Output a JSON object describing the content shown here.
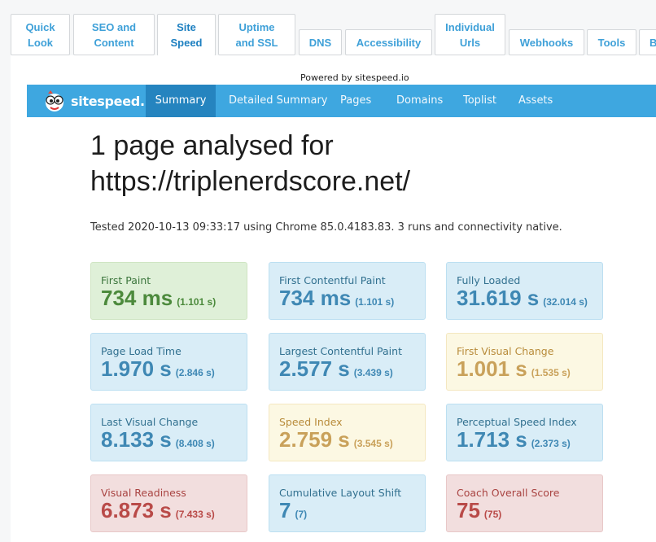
{
  "tabs": [
    {
      "label": "Quick\nLook",
      "active": false
    },
    {
      "label": "SEO and\nContent",
      "active": false
    },
    {
      "label": "Site\nSpeed",
      "active": true
    },
    {
      "label": "Uptime\nand SSL",
      "active": false
    },
    {
      "label": "DNS",
      "active": false
    },
    {
      "label": "Accessibility",
      "active": false
    },
    {
      "label": "Individual\nUrls",
      "active": false
    },
    {
      "label": "Webhooks",
      "active": false
    },
    {
      "label": "Tools",
      "active": false
    },
    {
      "label": "B",
      "active": false
    }
  ],
  "powered_by": "Powered by sitespeed.io",
  "navbar": {
    "brand": "sitespeed.io",
    "links": [
      "Summary",
      "Detailed Summary",
      "Pages",
      "Domains",
      "Toplist",
      "Assets"
    ],
    "active": "Summary"
  },
  "heading": "1 page analysed for https://triplenerdscore.net/",
  "tested": "Tested 2020-10-13 09:33:17 using Chrome 85.0.4183.83. 3 runs and connectivity native.",
  "metrics": [
    {
      "label": "First Paint",
      "value": "734 ms",
      "sub": "(1.101 s)",
      "status": "green"
    },
    {
      "label": "First Contentful Paint",
      "value": "734 ms",
      "sub": "(1.101 s)",
      "status": "blue"
    },
    {
      "label": "Fully Loaded",
      "value": "31.619 s",
      "sub": "(32.014 s)",
      "status": "blue"
    },
    {
      "label": "Page Load Time",
      "value": "1.970 s",
      "sub": "(2.846 s)",
      "status": "blue"
    },
    {
      "label": "Largest Contentful Paint",
      "value": "2.577 s",
      "sub": "(3.439 s)",
      "status": "blue"
    },
    {
      "label": "First Visual Change",
      "value": "1.001 s",
      "sub": "(1.535 s)",
      "status": "yellow"
    },
    {
      "label": "Last Visual Change",
      "value": "8.133 s",
      "sub": "(8.408 s)",
      "status": "blue"
    },
    {
      "label": "Speed Index",
      "value": "2.759 s",
      "sub": "(3.545 s)",
      "status": "yellow"
    },
    {
      "label": "Perceptual Speed Index",
      "value": "1.713 s",
      "sub": "(2.373 s)",
      "status": "blue"
    },
    {
      "label": "Visual Readiness",
      "value": "6.873 s",
      "sub": "(7.433 s)",
      "status": "red"
    },
    {
      "label": "Cumulative Layout Shift",
      "value": "7",
      "sub": "(7)",
      "status": "blue"
    },
    {
      "label": "Coach Overall Score",
      "value": "75",
      "sub": "(75)",
      "status": "red"
    }
  ]
}
